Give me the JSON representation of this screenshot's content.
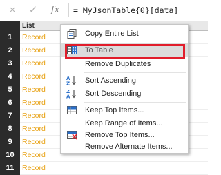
{
  "formula_bar": {
    "cancel_icon": "×",
    "accept_icon": "✓",
    "fx_label": "fx",
    "formula": "= MyJsonTable{0}[data]"
  },
  "grid": {
    "column_header": "List",
    "rows": [
      {
        "num": "1",
        "value": "Record"
      },
      {
        "num": "2",
        "value": "Record"
      },
      {
        "num": "3",
        "value": "Record"
      },
      {
        "num": "4",
        "value": "Record"
      },
      {
        "num": "5",
        "value": "Record"
      },
      {
        "num": "6",
        "value": "Record"
      },
      {
        "num": "7",
        "value": "Record"
      },
      {
        "num": "8",
        "value": "Record"
      },
      {
        "num": "9",
        "value": "Record"
      },
      {
        "num": "10",
        "value": "Record"
      },
      {
        "num": "11",
        "value": "Record"
      }
    ]
  },
  "context_menu": {
    "items": [
      {
        "label": "Copy Entire List",
        "icon": "copy-list-icon"
      },
      {
        "label": "To Table",
        "icon": "to-table-icon",
        "highlighted": true
      },
      {
        "label": "Remove Duplicates",
        "icon": ""
      },
      {
        "label": "Sort Ascending",
        "icon": "sort-ascending-icon"
      },
      {
        "label": "Sort Descending",
        "icon": "sort-descending-icon"
      },
      {
        "label": "Keep Top Items...",
        "icon": "keep-rows-icon"
      },
      {
        "label": "Keep Range of Items...",
        "icon": ""
      },
      {
        "label": "Remove Top Items...",
        "icon": "remove-rows-icon"
      },
      {
        "label": "Remove Alternate Items...",
        "icon": ""
      }
    ]
  },
  "colors": {
    "record_text": "#e8a317",
    "row_number_bg": "#2b2b2b",
    "highlight_box": "#e11d2b"
  }
}
